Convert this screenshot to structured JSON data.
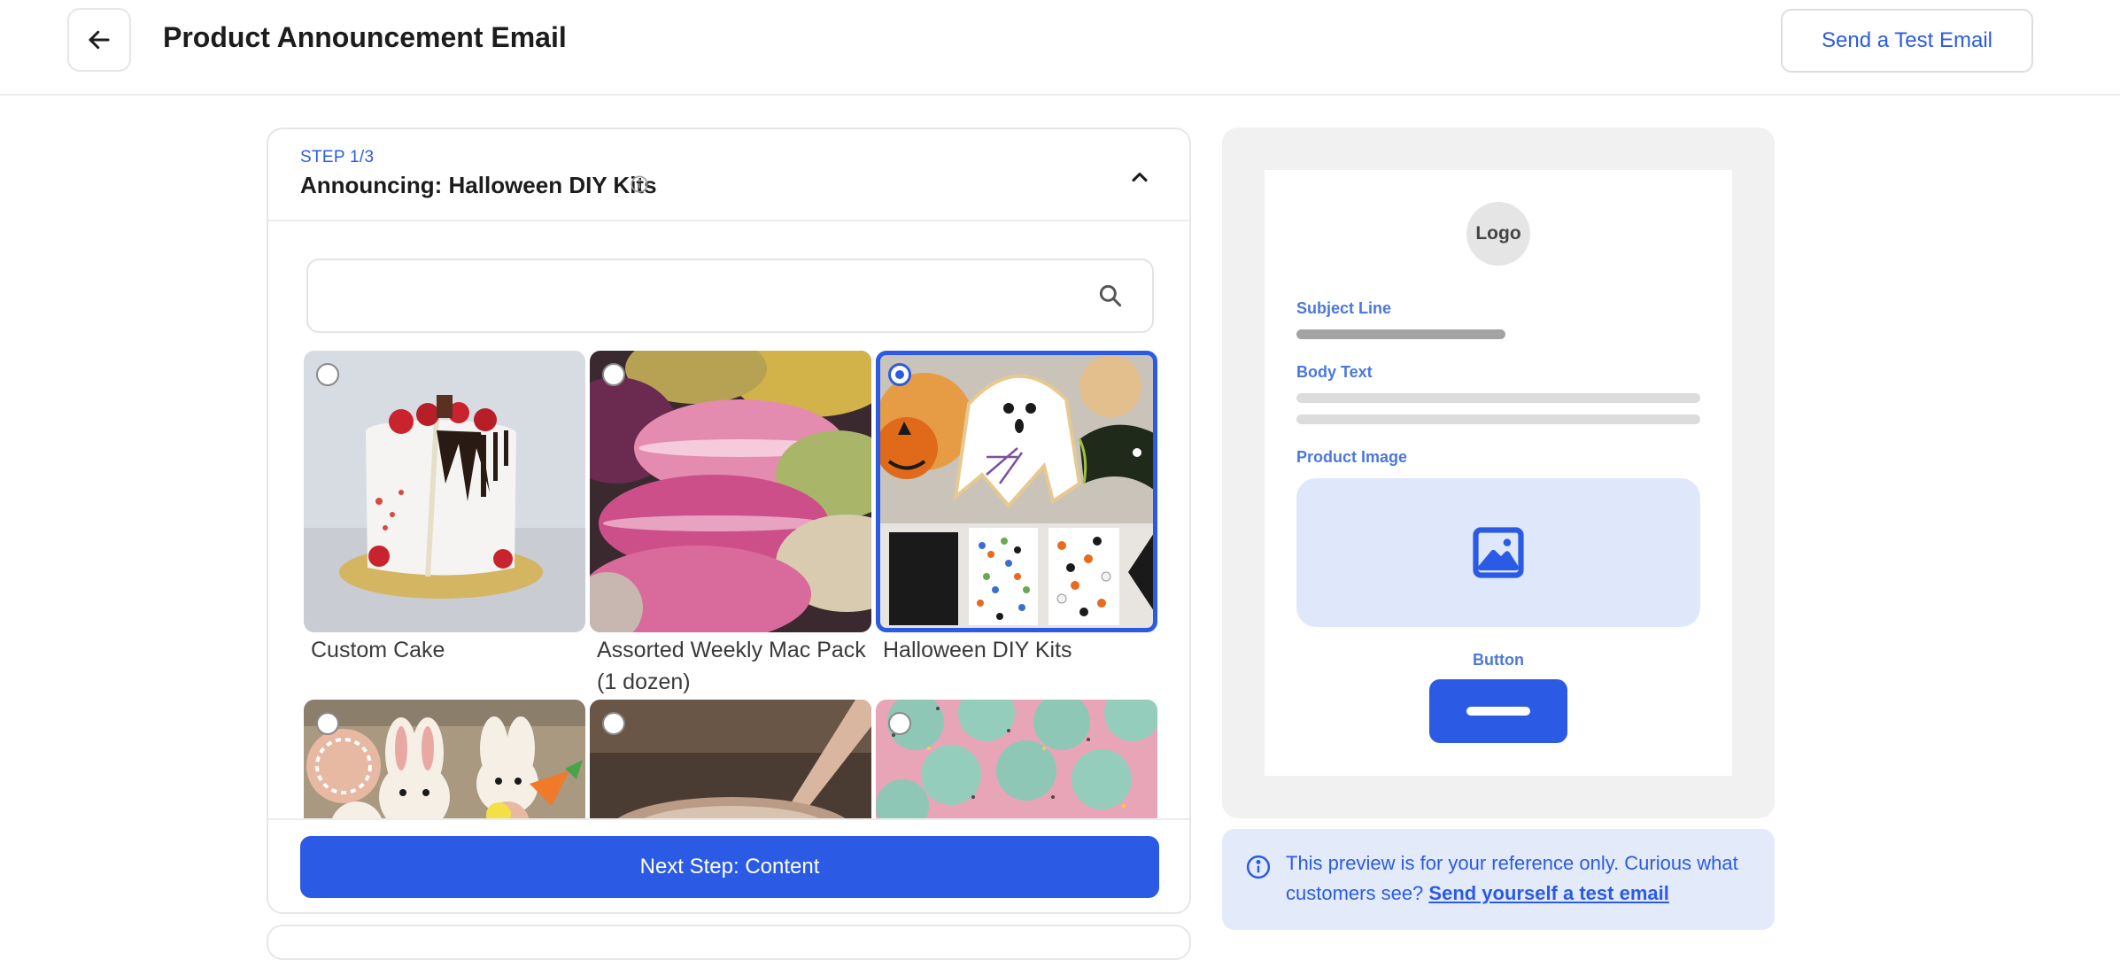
{
  "header": {
    "title": "Product Announcement Email",
    "back_icon": "arrow-left-icon",
    "test_email_button": "Send a Test Email"
  },
  "step": {
    "label": "STEP 1/3",
    "title": "Announcing: Halloween DIY Kits",
    "info_icon": "info-icon",
    "collapse_icon": "chevron-up-icon"
  },
  "search": {
    "placeholder": "",
    "value": "",
    "icon": "search-icon"
  },
  "products": [
    {
      "label": "Custom Cake",
      "selected": false
    },
    {
      "label": "Assorted Weekly Mac Pack (1 dozen)",
      "selected": false
    },
    {
      "label": "Halloween DIY Kits",
      "selected": true
    },
    {
      "label": "",
      "selected": false
    },
    {
      "label": "",
      "selected": false
    },
    {
      "label": "",
      "selected": false
    }
  ],
  "footer": {
    "next_button": "Next Step: Content"
  },
  "preview": {
    "logo": "Logo",
    "subject_line": "Subject Line",
    "body_text": "Body Text",
    "product_image": "Product Image",
    "product_image_icon": "image-icon",
    "button": "Button"
  },
  "notice": {
    "text": "This preview is for your reference only. Curious what customers see? ",
    "link": "Send yourself a test email"
  },
  "colors": {
    "accent": "#2b5be5",
    "preview_label": "#4b77de",
    "notice_bg": "#e3ebfb"
  }
}
